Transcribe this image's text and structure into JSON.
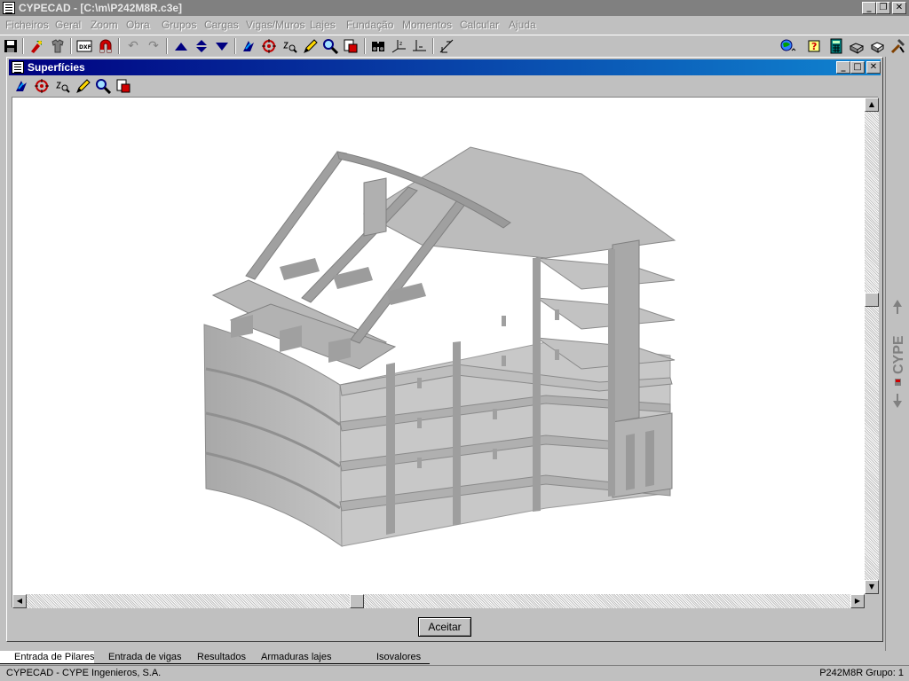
{
  "window": {
    "title": "CYPECAD - [C:\\m\\P242M8R.c3e]",
    "controls": [
      "_",
      "❐",
      "✕"
    ]
  },
  "menu": {
    "items": [
      {
        "label": "Ficheiros"
      },
      {
        "label": "Geral"
      },
      {
        "label": "Zoom"
      },
      {
        "label": "Obra"
      },
      {
        "label": "Grupos"
      },
      {
        "label": "Cargas"
      },
      {
        "label": "Vigas/Muros"
      },
      {
        "label": "Lajes"
      },
      {
        "label": "Fundação"
      },
      {
        "label": "Momentos"
      },
      {
        "label": "Calcular"
      },
      {
        "label": "Ajuda"
      }
    ]
  },
  "toolbar": {
    "icons": [
      "save-icon",
      "tool-icon",
      "shirt-icon",
      "dxf-icon",
      "magnet-icon",
      "undo-icon",
      "redo-icon",
      "up-arrow-icon",
      "up-down-arrow-icon",
      "down-arrow-icon",
      "rotate-view-icon",
      "zoom-window-icon",
      "zoom-icon",
      "pencil-icon",
      "magnifier-icon",
      "redraw-icon",
      "binoculars-icon",
      "axes-icon",
      "axes-level-icon",
      "measure-icon",
      "globe-icon",
      "help-icon",
      "calculator-icon",
      "printer-icon",
      "print-preview-icon",
      "hammer-icon"
    ]
  },
  "child_window": {
    "title": "Superfícies",
    "controls": [
      "_",
      "□",
      "✕"
    ],
    "subtoolbar_icons": [
      "rotate-view-icon",
      "zoom-window-icon",
      "zoom-icon",
      "pencil-icon",
      "magnifier-icon",
      "redraw-icon"
    ],
    "accept_label": "Aceitar"
  },
  "side_panel": {
    "logo_text": "CYPE"
  },
  "tabs": [
    {
      "label": "Entrada de Pilares",
      "active": true
    },
    {
      "label": "Entrada de vigas",
      "active": false
    },
    {
      "label": "Resultados",
      "active": false
    },
    {
      "label": "Armaduras lajes vigotas",
      "active": false
    },
    {
      "label": "Isovalores",
      "active": false
    }
  ],
  "status": {
    "left": "CYPECAD - CYPE Ingenieros, S.A.",
    "right": "P242M8R Grupo:  1"
  },
  "colors": {
    "title_inactive": "#808080",
    "child_title_start": "#000080",
    "child_title_end": "#1084d0",
    "model_gray": "#bdbdbd"
  }
}
